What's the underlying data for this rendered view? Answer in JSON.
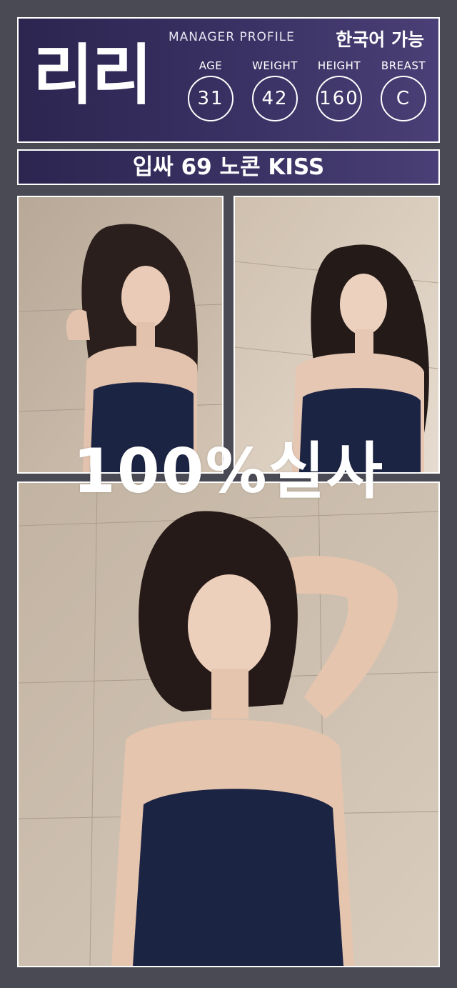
{
  "profile": {
    "name": "리리",
    "section_label": "MANAGER PROFILE",
    "language_note": "한국어 가능",
    "stats": [
      {
        "label": "AGE",
        "value": "31"
      },
      {
        "label": "WEIGHT",
        "value": "42"
      },
      {
        "label": "HEIGHT",
        "value": "160"
      },
      {
        "label": "BREAST",
        "value": "C"
      }
    ]
  },
  "tagline": "입싸 69 노콘 KISS",
  "overlay_text": "100%실사",
  "photos": [
    {
      "icon": "photo-woman-portrait"
    },
    {
      "icon": "photo-woman-portrait"
    },
    {
      "icon": "photo-woman-portrait"
    }
  ],
  "colors": {
    "page_background": "#4a4a55",
    "header_gradient_start": "#2c2550",
    "header_gradient_end": "#4a3f76",
    "border": "#ffffff",
    "top_dress": "#1c2444"
  }
}
